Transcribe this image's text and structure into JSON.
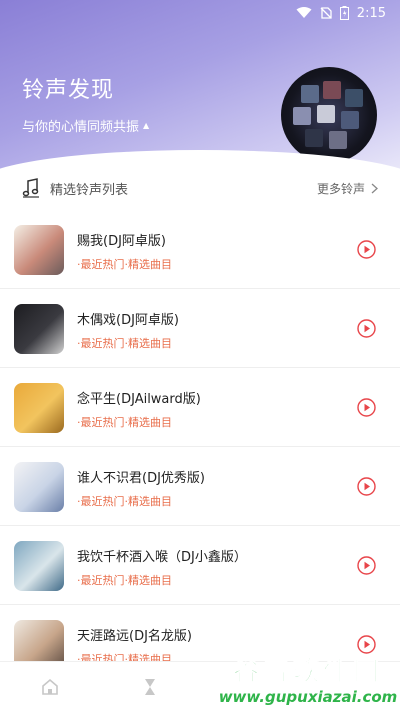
{
  "status_bar": {
    "time": "2:15"
  },
  "hero": {
    "title": "铃声发现",
    "subtitle": "与你的心情同频共振",
    "caret": "▲"
  },
  "section": {
    "title": "精选铃声列表",
    "more": "更多铃声"
  },
  "songs": [
    {
      "title": "赐我(DJ阿卓版)",
      "tag": "·最近热门·精选曲目",
      "thumb_colors": [
        "#f4efe6",
        "#c98a7a",
        "#6b5b5b"
      ]
    },
    {
      "title": "木偶戏(DJ阿卓版)",
      "tag": "·最近热门·精选曲目",
      "thumb_colors": [
        "#1c1c20",
        "#3a3a40",
        "#d0d0d0"
      ]
    },
    {
      "title": "念平生(DJAilward版)",
      "tag": "·最近热门·精选曲目",
      "thumb_colors": [
        "#e9a93a",
        "#f2c45e",
        "#9b6a1f"
      ]
    },
    {
      "title": "谁人不识君(DJ优秀版)",
      "tag": "·最近热门·精选曲目",
      "thumb_colors": [
        "#f3f3f5",
        "#c9d4e6",
        "#6a7fa8"
      ]
    },
    {
      "title": "我饮千杯酒入喉（DJ小鑫版）",
      "tag": "·最近热门·精选曲目",
      "thumb_colors": [
        "#7fa7c0",
        "#d9e5ea",
        "#3f6a88"
      ]
    },
    {
      "title": "天涯路远(DJ名龙版)",
      "tag": "·最近热门·精选曲目",
      "thumb_colors": [
        "#efe9e1",
        "#c7a58a",
        "#5a4a40"
      ]
    }
  ],
  "watermark": {
    "main": "谷普软件园",
    "url": "www.gupuxiazai.com"
  },
  "colors": {
    "accent": "#e8454a",
    "tag": "#e86d4a",
    "hero_top": "#8a7fd6"
  }
}
